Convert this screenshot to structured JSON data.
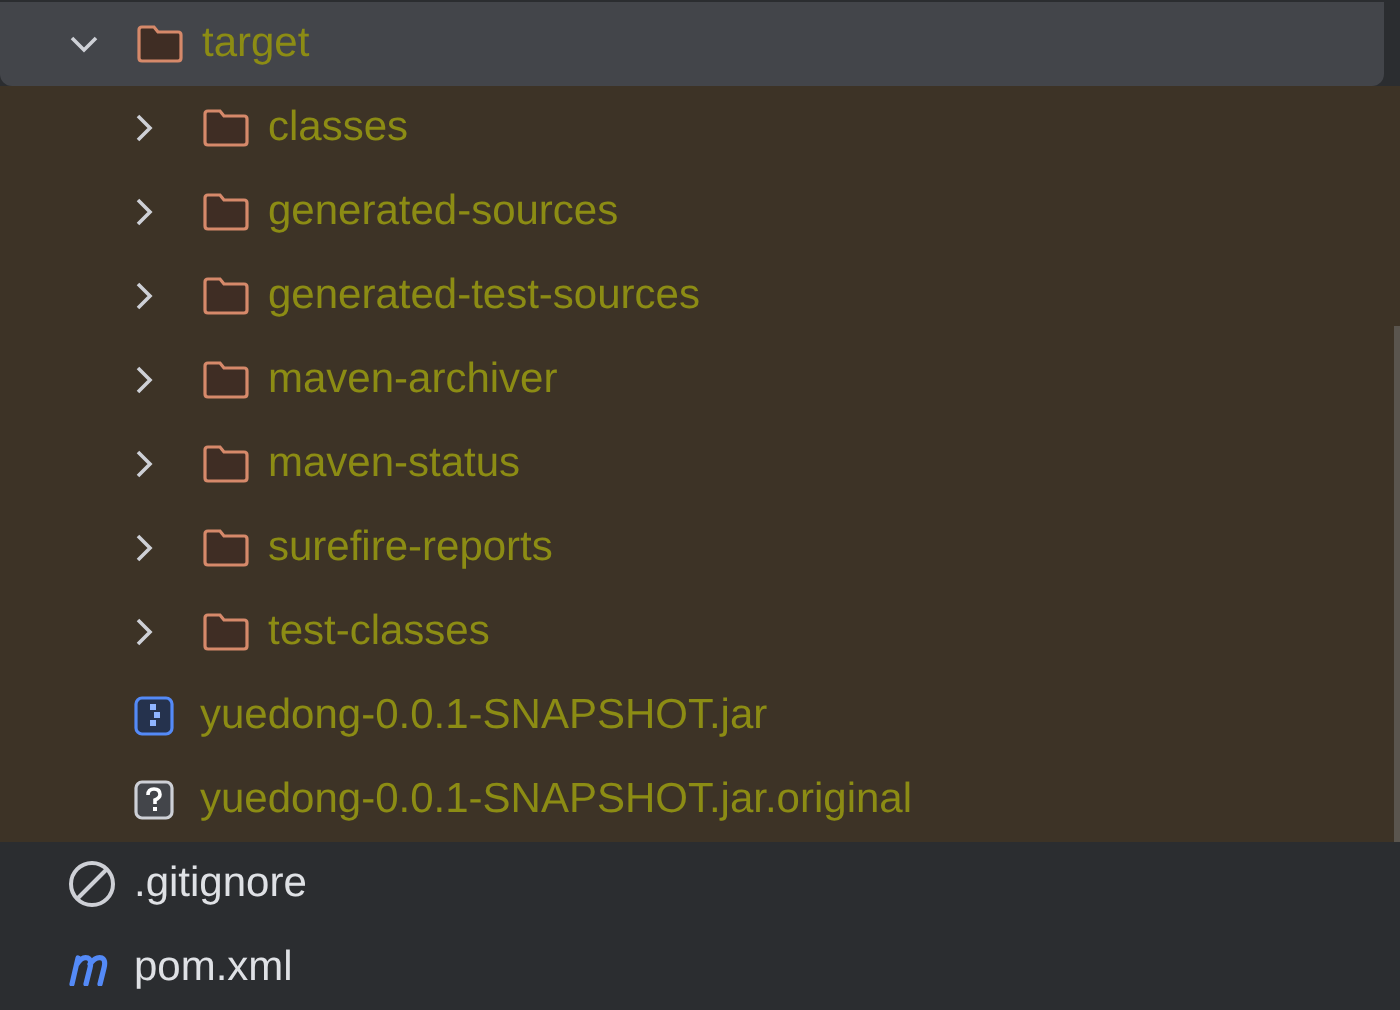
{
  "tree": [
    {
      "name": "target",
      "kind": "folder",
      "expanded": true,
      "selected": true,
      "excluded": true,
      "children": [
        {
          "name": "classes",
          "kind": "folder",
          "expanded": false,
          "selected": false,
          "excluded": true
        },
        {
          "name": "generated-sources",
          "kind": "folder",
          "expanded": false,
          "selected": false,
          "excluded": true
        },
        {
          "name": "generated-test-sources",
          "kind": "folder",
          "expanded": false,
          "selected": false,
          "excluded": true
        },
        {
          "name": "maven-archiver",
          "kind": "folder",
          "expanded": false,
          "selected": false,
          "excluded": true
        },
        {
          "name": "maven-status",
          "kind": "folder",
          "expanded": false,
          "selected": false,
          "excluded": true
        },
        {
          "name": "surefire-reports",
          "kind": "folder",
          "expanded": false,
          "selected": false,
          "excluded": true
        },
        {
          "name": "test-classes",
          "kind": "folder",
          "expanded": false,
          "selected": false,
          "excluded": true
        },
        {
          "name": "yuedong-0.0.1-SNAPSHOT.jar",
          "kind": "jar",
          "selected": false,
          "excluded": true
        },
        {
          "name": "yuedong-0.0.1-SNAPSHOT.jar.original",
          "kind": "unknown",
          "selected": false,
          "excluded": true
        }
      ]
    },
    {
      "name": ".gitignore",
      "kind": "ignore",
      "selected": false,
      "excluded": false
    },
    {
      "name": "pom.xml",
      "kind": "maven",
      "selected": false,
      "excluded": false
    }
  ]
}
